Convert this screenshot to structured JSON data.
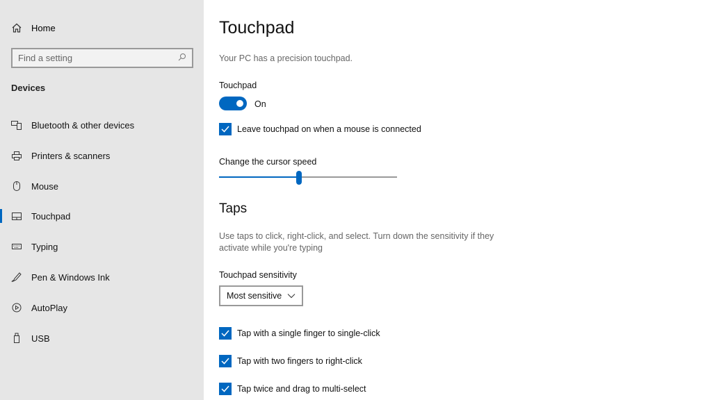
{
  "sidebar": {
    "home": "Home",
    "search_placeholder": "Find a setting",
    "section": "Devices",
    "items": [
      {
        "label": "Bluetooth & other devices",
        "icon": "bluetooth-devices-icon"
      },
      {
        "label": "Printers & scanners",
        "icon": "printer-icon"
      },
      {
        "label": "Mouse",
        "icon": "mouse-icon"
      },
      {
        "label": "Touchpad",
        "icon": "touchpad-icon",
        "selected": true
      },
      {
        "label": "Typing",
        "icon": "keyboard-icon"
      },
      {
        "label": "Pen & Windows Ink",
        "icon": "pen-icon"
      },
      {
        "label": "AutoPlay",
        "icon": "autoplay-icon"
      },
      {
        "label": "USB",
        "icon": "usb-icon"
      }
    ]
  },
  "main": {
    "title": "Touchpad",
    "subtitle": "Your PC has a precision touchpad.",
    "touchpad_label": "Touchpad",
    "toggle_state": "On",
    "leave_on_label": "Leave touchpad on when a mouse is connected",
    "leave_on_checked": true,
    "cursor_speed_label": "Change the cursor speed",
    "cursor_speed_percent": 45,
    "taps_heading": "Taps",
    "taps_desc": "Use taps to click, right-click, and select. Turn down the sensitivity if they activate while you're typing",
    "sensitivity_label": "Touchpad sensitivity",
    "sensitivity_value": "Most sensitive",
    "tap_options": [
      {
        "label": "Tap with a single finger to single-click",
        "checked": true
      },
      {
        "label": "Tap with two fingers to right-click",
        "checked": true
      },
      {
        "label": "Tap twice and drag to multi-select",
        "checked": true
      }
    ]
  },
  "colors": {
    "accent": "#0067c0",
    "sidebar_bg": "#e6e6e6"
  }
}
